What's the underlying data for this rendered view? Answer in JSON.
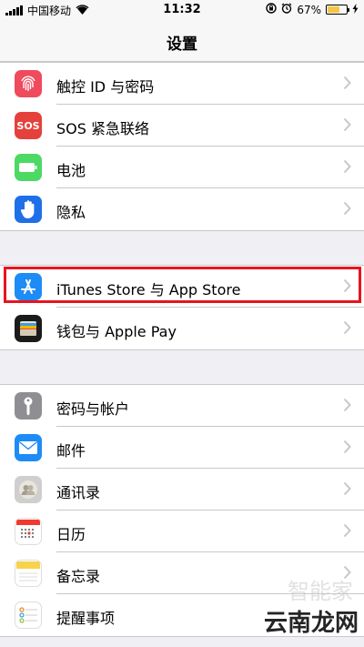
{
  "status_bar": {
    "carrier": "中国移动",
    "time": "11:32",
    "battery_percent": "67%",
    "battery_level": 0.67
  },
  "nav": {
    "title": "设置"
  },
  "groups": [
    {
      "items": [
        {
          "label": "触控 ID 与密码",
          "icon": "fingerprint-icon",
          "color": "#ef4b5d"
        },
        {
          "label": "SOS 紧急联络",
          "icon": "sos-icon",
          "icon_text": "SOS",
          "color": "#e5413c"
        },
        {
          "label": "电池",
          "icon": "battery-icon",
          "color": "#4cd964"
        },
        {
          "label": "隐私",
          "icon": "hand-icon",
          "color": "#1f6fe8"
        }
      ]
    },
    {
      "items": [
        {
          "label": "iTunes Store 与 App Store",
          "icon": "app-store-icon",
          "color": "#1e8cf6"
        },
        {
          "label": "钱包与 Apple Pay",
          "icon": "wallet-icon",
          "color": "#1b1b1b"
        }
      ]
    },
    {
      "items": [
        {
          "label": "密码与帐户",
          "icon": "key-icon",
          "color": "#8e8e93"
        },
        {
          "label": "邮件",
          "icon": "mail-icon",
          "color": "#1e8cf6"
        },
        {
          "label": "通讯录",
          "icon": "contacts-icon",
          "color": "#b0b0b0"
        },
        {
          "label": "日历",
          "icon": "calendar-icon",
          "color": "#ffffff"
        },
        {
          "label": "备忘录",
          "icon": "notes-icon",
          "color": "#ffffff"
        },
        {
          "label": "提醒事项",
          "icon": "reminders-icon",
          "color": "#ffffff"
        }
      ]
    }
  ],
  "watermark": {
    "brand": "云南龙网",
    "faint": "智能家"
  },
  "accent": {
    "highlight": "#e8141e",
    "background": "#efeff4",
    "separator": "#c8c7cc"
  }
}
